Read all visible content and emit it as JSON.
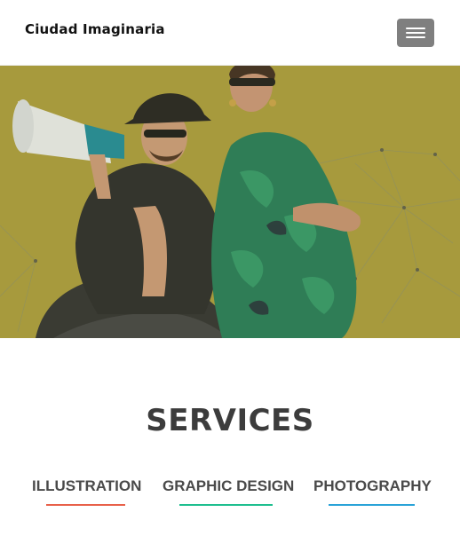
{
  "navbar": {
    "brand": "Ciudad Imaginaria",
    "toggler_icon": "hamburger-menu-icon",
    "toggler_color": "#7f7f7f"
  },
  "hero": {
    "background_color": "#a89a3f",
    "image_description_icon": "hero-photo"
  },
  "services": {
    "title": "SERVICES",
    "tabs": [
      {
        "label": "ILLUSTRATION",
        "accent": "#e8614a"
      },
      {
        "label": "GRAPHIC DESIGN",
        "accent": "#1fbf8f"
      },
      {
        "label": "PHOTOGRAPHY",
        "accent": "#2aa3d8"
      }
    ]
  }
}
